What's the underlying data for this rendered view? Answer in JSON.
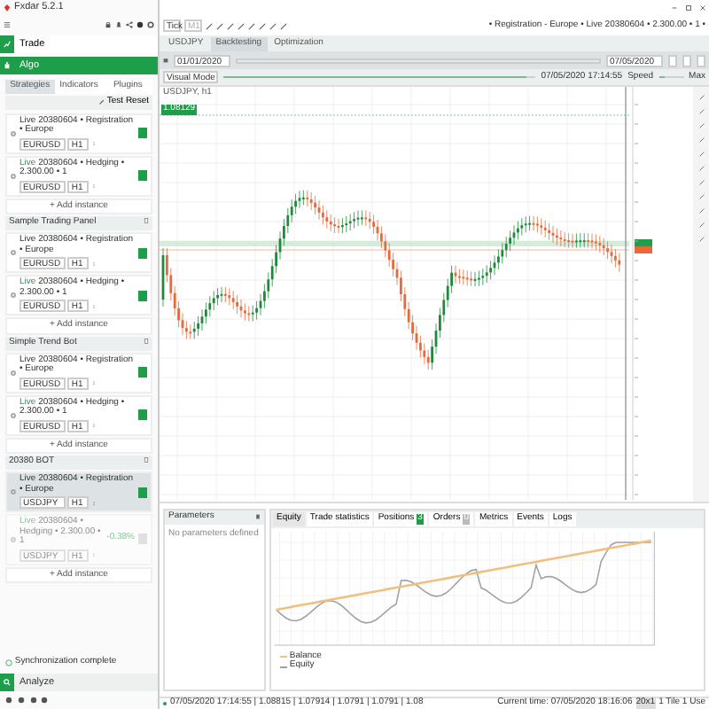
{
  "window": {
    "title": "Fxdar 5.2.1"
  },
  "sidebar": {
    "sections": [
      {
        "label": "Trade",
        "selected": false
      },
      {
        "label": "Algo",
        "selected": true
      }
    ],
    "tabs": [
      {
        "label": "Strategies",
        "selected": true
      },
      {
        "label": "Indicators",
        "selected": false
      },
      {
        "label": "Plugins",
        "selected": false
      }
    ],
    "actions": [
      "Test",
      "Reset"
    ],
    "groups": [
      {
        "instances": [
          {
            "mode": "Live",
            "mode_highlight": false,
            "name": "20380604 • Registration • Europe",
            "symbol": "EURUSD",
            "timeframe": "H1",
            "selected": false,
            "disabled": false,
            "running": true
          },
          {
            "mode": "Live",
            "mode_highlight": true,
            "name": "20380604 • Hedging • 2.300.00 • 1",
            "symbol": "EURUSD",
            "timeframe": "H1",
            "selected": false,
            "disabled": false,
            "running": true
          }
        ],
        "add_label": "+ Add instance"
      },
      {
        "title": "Sample Trading Panel",
        "instances": [
          {
            "mode": "Live",
            "mode_highlight": false,
            "name": "20380604 • Registration • Europe",
            "symbol": "EURUSD",
            "timeframe": "H1",
            "selected": false,
            "disabled": false,
            "running": true
          },
          {
            "mode": "Live",
            "mode_highlight": true,
            "name": "20380604 • Hedging • 2.300.00 • 1",
            "symbol": "EURUSD",
            "timeframe": "H1",
            "selected": false,
            "disabled": false,
            "running": true
          }
        ],
        "add_label": "+ Add instance"
      },
      {
        "title": "Simple Trend Bot",
        "instances": [
          {
            "mode": "Live",
            "mode_highlight": false,
            "name": "20380604 • Registration • Europe",
            "symbol": "EURUSD",
            "timeframe": "H1",
            "selected": false,
            "disabled": false,
            "running": true
          },
          {
            "mode": "Live",
            "mode_highlight": true,
            "name": "20380604 • Hedging • 2.300.00 • 1",
            "symbol": "EURUSD",
            "timeframe": "H1",
            "selected": false,
            "disabled": false,
            "running": true
          }
        ],
        "add_label": "+ Add instance"
      },
      {
        "title": "20380 BOT",
        "instances": [
          {
            "mode": "Live",
            "mode_highlight": false,
            "name": "20380604 • Registration • Europe",
            "symbol": "USDJPY",
            "timeframe": "H1",
            "selected": true,
            "disabled": false,
            "running": true
          },
          {
            "mode": "Live",
            "mode_highlight": true,
            "name": "20380604 • Hedging • 2.300.00 • 1",
            "symbol": "USDJPY",
            "timeframe": "H1",
            "selected": false,
            "disabled": true,
            "running": false,
            "pnl": "-0.38%"
          }
        ],
        "add_label": "+ Add instance"
      }
    ],
    "status": "Synchronization complete",
    "bottom": {
      "label": "Analyze",
      "selected": true
    }
  },
  "toolbar": {
    "chart_type": "Tick",
    "period": "M1",
    "account": "• Registration - Europe • Live 20380604 • 2.300.00 • 1 •"
  },
  "tabs": [
    {
      "label": "USDJPY",
      "selected": false
    },
    {
      "label": "Backtesting",
      "selected": true
    },
    {
      "label": "Optimization",
      "selected": false
    }
  ],
  "range": {
    "from": "01/01/2020",
    "to": "07/05/2020",
    "level": 1
  },
  "visual": {
    "label": "Visual Mode",
    "level": 0.97,
    "time": "07/05/2020 17:14:55",
    "speed": {
      "label": "Speed",
      "level": 0.25
    },
    "max_label": "Max"
  },
  "chart": {
    "legend": "USDJPY, h1",
    "badge": "1.08129"
  },
  "parameters": {
    "title": "Parameters",
    "empty": "No parameters defined"
  },
  "results": {
    "tabs": [
      {
        "label": "Equity",
        "selected": true
      },
      {
        "label": "Trade statistics",
        "selected": false
      },
      {
        "label": "Positions",
        "selected": false,
        "count": "3",
        "count_active": true
      },
      {
        "label": "Orders",
        "selected": false,
        "count": "0",
        "count_active": false
      },
      {
        "label": "Metrics",
        "selected": false
      },
      {
        "label": "Events",
        "selected": false
      },
      {
        "label": "Logs",
        "selected": false
      }
    ],
    "legend": [
      {
        "label": "Balance",
        "color": "#f0c080"
      },
      {
        "label": "Equity",
        "color": "#a0a0a0"
      }
    ]
  },
  "status_bar": {
    "left": "07/05/2020 17:14:55 | 1.08815 | 1.07914 | 1.0791 | 1.0791 | 1.08",
    "right": "Current time: 07/05/2020 18:16:06",
    "zoom": "20x1",
    "page": "1 Tile 1 Use"
  }
}
